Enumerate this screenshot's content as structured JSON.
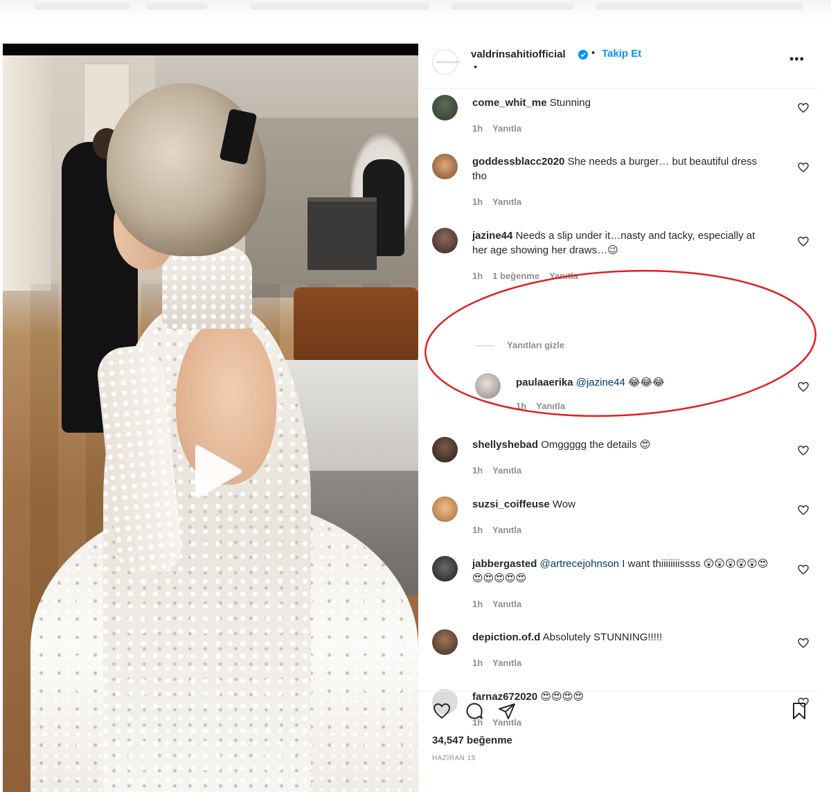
{
  "post": {
    "author": "valdrinsahitiofficial",
    "author_logo_text": "VALDRIN SAHITI",
    "verified": true,
    "separator": "•",
    "follow_label": "Takip Et",
    "subtitle": "•",
    "more_label": "•••",
    "video": {
      "play_icon": "play-icon",
      "mute_icon": "speaker-muted-icon"
    }
  },
  "comments": [
    {
      "username": "come_whit_me",
      "text": "Stunning",
      "time": "1h",
      "likes": "",
      "reply_label": "Yanıtla",
      "avatar_color": "#2f3b2c"
    },
    {
      "username": "goddessblacc2020",
      "text": "She needs a burger… but beautiful dress tho",
      "time": "1h",
      "likes": "",
      "reply_label": "Yanıtla",
      "avatar_color": "#b07a4a"
    },
    {
      "username": "jazine44",
      "text": "Needs a slip under it…nasty and tacky, especially at her age showing her draws…😉",
      "time": "1h",
      "likes": "1 beğenme",
      "reply_label": "Yanıtla",
      "avatar_color": "#4b3a3a"
    },
    {
      "username": "shellyshebad",
      "text": "Omggggg the details 😍",
      "time": "1h",
      "likes": "",
      "reply_label": "Yanıtla",
      "avatar_color": "#3b2f2a"
    },
    {
      "username": "suzsi_coiffeuse",
      "text": "Wow",
      "time": "1h",
      "likes": "",
      "reply_label": "Yanıtla",
      "avatar_color": "#c58a4e"
    },
    {
      "username": "jabbergasted",
      "mention": "@artrecejohnson",
      "text": "I want thiiiiiiiissss 😲😲😲😲😲😍😍😍😍😍😍",
      "time": "1h",
      "likes": "",
      "reply_label": "Yanıtla",
      "avatar_color": "#2a2a2a"
    },
    {
      "username": "depiction.of.d",
      "text": "Absolutely STUNNING!!!!!",
      "time": "1h",
      "likes": "",
      "reply_label": "Yanıtla",
      "avatar_color": "#6b4a36"
    },
    {
      "username": "farnaz672020",
      "text": "😍😍😍😍",
      "time": "1h",
      "likes": "",
      "reply_label": "Yanıtla",
      "avatar_color": "#dcdcdc"
    }
  ],
  "hide_replies_label": "Yanıtları gizle",
  "reply": {
    "username": "paulaaerika",
    "mention": "@jazine44",
    "text": "😂😂😂",
    "time": "1h",
    "reply_label": "Yanıtla",
    "avatar_color": "#a9a3a0"
  },
  "footer": {
    "likes": "34,547 beğenme",
    "date": "HAZİRAN 15"
  },
  "colors": {
    "accent": "#0095f6",
    "annotation": "#e02020",
    "text": "#262626",
    "muted": "#8e8e8e"
  }
}
